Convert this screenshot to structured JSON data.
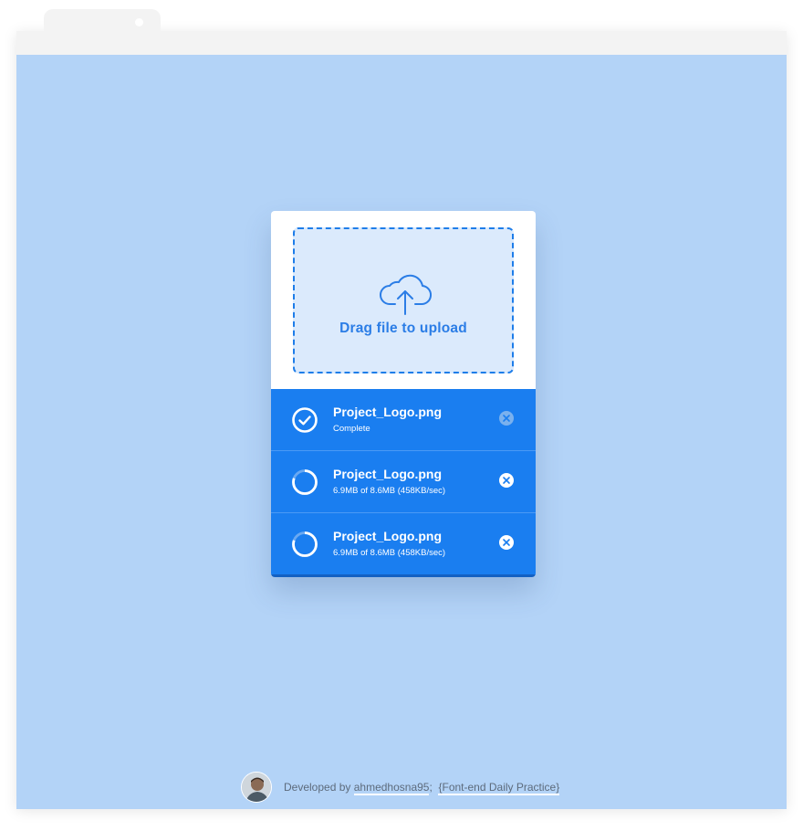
{
  "dropzone": {
    "label": "Drag file to upload",
    "icon": "cloud-upload-icon"
  },
  "files": [
    {
      "name": "Project_Logo.png",
      "status": "Complete",
      "state": "complete",
      "progress": 1.0
    },
    {
      "name": "Project_Logo.png",
      "status": "6.9MB of 8.6MB (458KB/sec)",
      "state": "uploading",
      "progress": 0.8
    },
    {
      "name": "Project_Logo.png",
      "status": "6.9MB of 8.6MB (458KB/sec)",
      "state": "uploading",
      "progress": 0.8
    }
  ],
  "footer": {
    "prefix": "Developed by",
    "author": "ahmedhosna95",
    "separator": ";",
    "project": "{Font-end Daily Practice}"
  },
  "colors": {
    "background": "#b3d3f7",
    "accent": "#1a7ef0",
    "dropzone_fill": "#dbeafc",
    "dropzone_border": "#1e7de9"
  }
}
